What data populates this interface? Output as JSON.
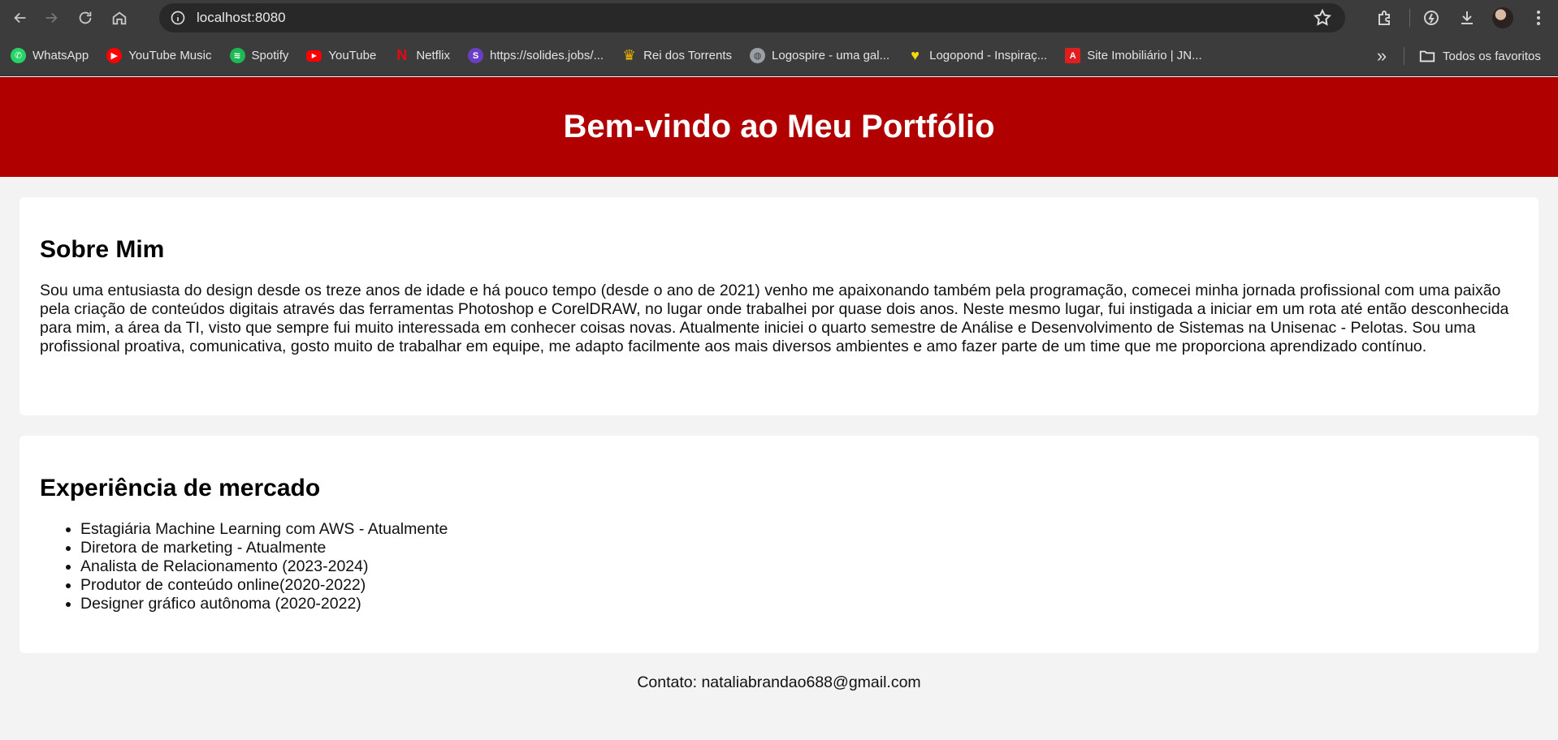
{
  "browser": {
    "url": "localhost:8080",
    "bookmarks": [
      {
        "label": "WhatsApp",
        "icon": "whatsapp-icon",
        "color": "#25d366"
      },
      {
        "label": "YouTube Music",
        "icon": "youtube-music-icon",
        "color": "#ff0000"
      },
      {
        "label": "Spotify",
        "icon": "spotify-icon",
        "color": "#1db954"
      },
      {
        "label": "YouTube",
        "icon": "youtube-icon",
        "color": "#ff0000"
      },
      {
        "label": "Netflix",
        "icon": "netflix-icon",
        "color": "#e50914"
      },
      {
        "label": "https://solides.jobs/...",
        "icon": "solides-icon",
        "color": "#6a3fc6"
      },
      {
        "label": "Rei dos Torrents",
        "icon": "crown-icon",
        "color": "#f2b700"
      },
      {
        "label": "Logospire - uma gal...",
        "icon": "globe-icon",
        "color": "#9aa0a6"
      },
      {
        "label": "Logopond - Inspiraç...",
        "icon": "logopond-icon",
        "color": "#f5d90a"
      },
      {
        "label": "Site Imobiliário | JN...",
        "icon": "adobe-icon",
        "color": "#e01e1e"
      }
    ],
    "all_bookmarks_label": "Todos os favoritos"
  },
  "page": {
    "header_title": "Bem-vindo ao Meu Portfólio",
    "about": {
      "title": "Sobre Mim",
      "text": "Sou uma entusiasta do design desde os treze anos de idade e há pouco tempo (desde o ano de 2021) venho me apaixonando também pela programação, comecei minha jornada profissional com uma paixão pela criação de conteúdos digitais através das ferramentas Photoshop e CorelDRAW, no lugar onde trabalhei por quase dois anos. Neste mesmo lugar, fui instigada a iniciar em um rota até então desconhecida para mim, a área da TI, visto que sempre fui muito interessada em conhecer coisas novas. Atualmente iniciei o quarto semestre de Análise e Desenvolvimento de Sistemas na Unisenac - Pelotas. Sou uma profissional proativa, comunicativa, gosto muito de trabalhar em equipe, me adapto facilmente aos mais diversos ambientes e amo fazer parte de um time que me proporciona aprendizado contínuo."
    },
    "experience": {
      "title": "Experiência de mercado",
      "items": [
        "Estagiária Machine Learning com AWS - Atualmente",
        "Diretora de marketing - Atualmente",
        "Analista de Relacionamento (2023-2024)",
        "Produtor de conteúdo online(2020-2022)",
        "Designer gráfico autônoma (2020-2022)"
      ]
    },
    "footer": "Contato: nataliabrandao688@gmail.com"
  },
  "colors": {
    "header_bg": "#b00000",
    "page_bg": "#f3f3f3",
    "card_bg": "#ffffff",
    "chrome_bg": "#3c3c3c"
  }
}
